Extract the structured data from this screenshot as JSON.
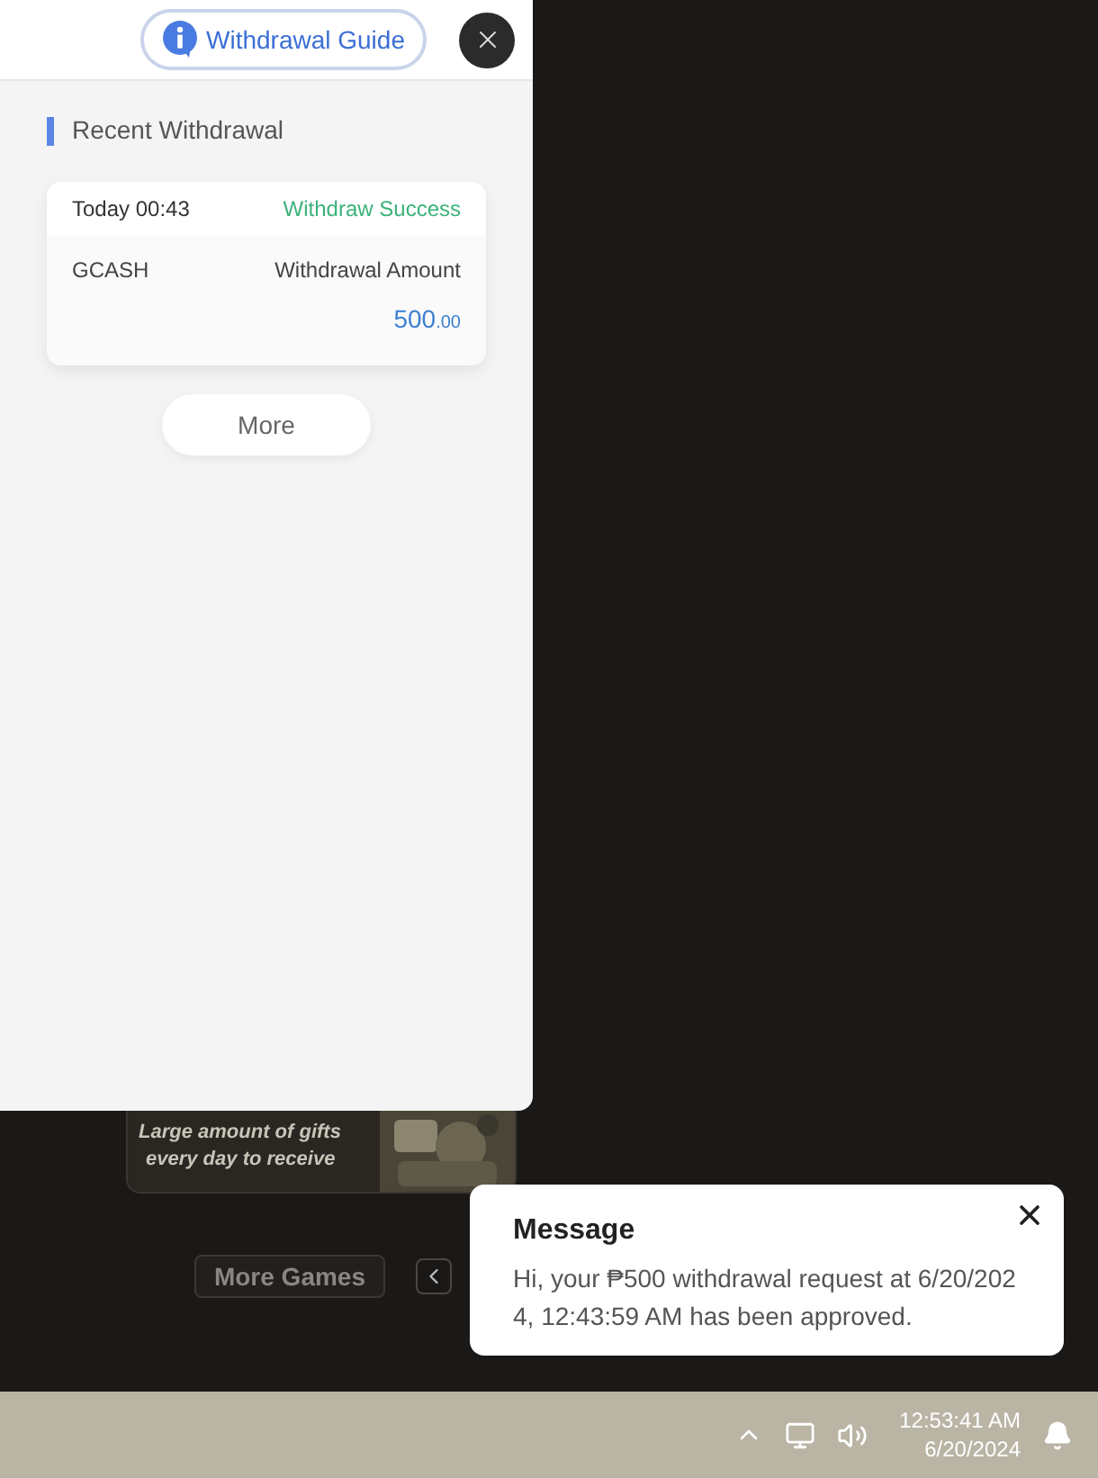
{
  "panel": {
    "guide_button": {
      "label": "Withdrawal Guide"
    },
    "section_title": "Recent Withdrawal",
    "records": [
      {
        "time": "Today 00:43",
        "status": "Withdraw Success",
        "method": "GCASH",
        "amount_label": "Withdrawal Amount",
        "amount_whole": "500",
        "amount_decimal": ".00"
      }
    ],
    "more_button": "More"
  },
  "banner": {
    "caption_lines": [
      "Large amount of gifts",
      "every day to receive"
    ]
  },
  "more_games_button": "More Games",
  "toast": {
    "title": "Message",
    "body": "Hi, your ₱500 withdrawal request at 6/20/2024, 12:43:59 AM has been approved."
  },
  "taskbar": {
    "time": "12:53:41 AM",
    "date": "6/20/2024"
  }
}
